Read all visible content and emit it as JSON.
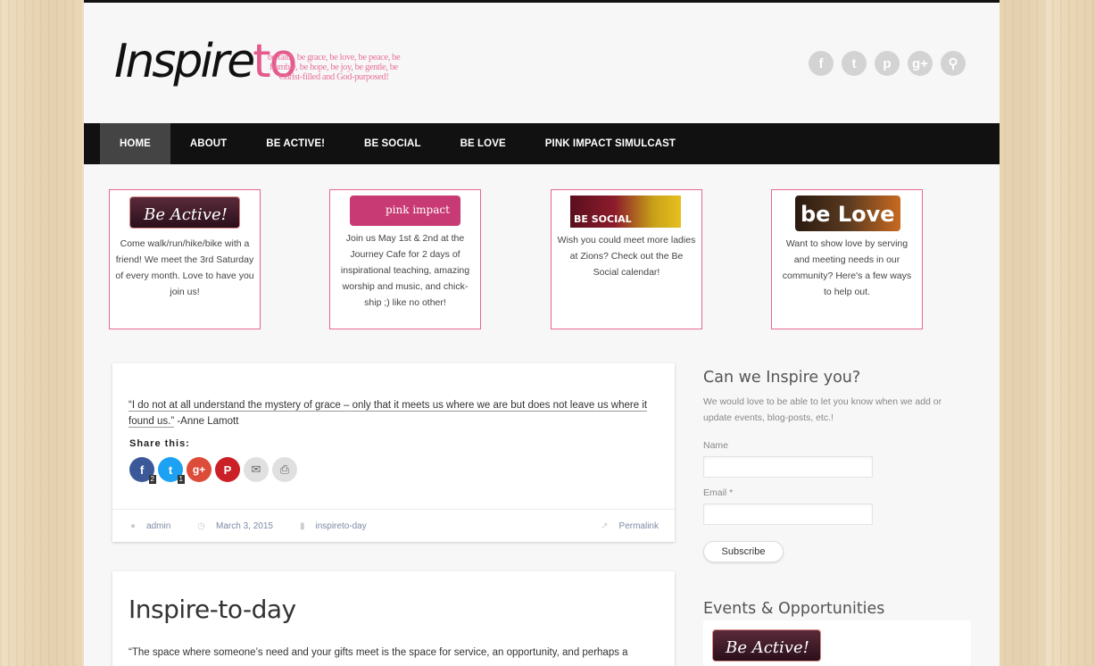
{
  "header": {
    "logo_main": "Inspire",
    "logo_accent": "to",
    "tagline": "be faith, be grace, be love, be peace, be humble, be hope, be joy, be gentle, be Christ-filled and God-purposed!",
    "social_icons": [
      {
        "name": "facebook-icon",
        "glyph": "f"
      },
      {
        "name": "twitter-icon",
        "glyph": "t"
      },
      {
        "name": "pinterest-icon",
        "glyph": "p"
      },
      {
        "name": "google-plus-icon",
        "glyph": "g+"
      },
      {
        "name": "search-icon",
        "glyph": "⚲"
      }
    ]
  },
  "nav": {
    "items": [
      "HOME",
      "ABOUT",
      "BE ACTIVE!",
      "BE SOCIAL",
      "BE LOVE",
      "PINK IMPACT SIMULCAST"
    ],
    "active_index": 0
  },
  "features": [
    {
      "badge": "Be Active!",
      "text": "Come walk/run/hike/bike with a friend! We meet the 3rd Saturday of every month. Love to have you join us!"
    },
    {
      "badge": "pink impact",
      "text": "Join us May 1st & 2nd at the Journey Cafe for 2 days of inspirational teaching, amazing worship and music, and chick-ship ;) like no other!"
    },
    {
      "badge": "BE SOCIAL",
      "text": "Wish you could meet more ladies at Zions? Check out the Be Social calendar!"
    },
    {
      "badge": "be Love",
      "text": "Want to show love by serving and meeting needs in our community? Here's a few ways to help out."
    }
  ],
  "post1": {
    "quote_link": "“I do not at all understand the mystery of grace – only that it meets us where we are but does not leave us where it found us.”",
    "quote_author": " -Anne Lamott",
    "share_title": "Share this:",
    "share_buttons": [
      {
        "name": "facebook-share-button",
        "glyph": "f",
        "count": "2",
        "color": "#3b5998"
      },
      {
        "name": "twitter-share-button",
        "glyph": "t",
        "count": "1",
        "color": "#1da1f2"
      },
      {
        "name": "google-plus-share-button",
        "glyph": "g+",
        "count": "",
        "color": "#dd4b39"
      },
      {
        "name": "pinterest-share-button",
        "glyph": "P",
        "count": "",
        "color": "#cb2027"
      },
      {
        "name": "email-share-button",
        "glyph": "✉",
        "count": "",
        "color": "#e0e0e0"
      },
      {
        "name": "print-share-button",
        "glyph": "⎙",
        "count": "",
        "color": "#e0e0e0"
      }
    ],
    "author": "admin",
    "date": "March 3, 2015",
    "category": "inspireto-day",
    "permalink": "Permalink"
  },
  "post2": {
    "title": "Inspire-to-day",
    "excerpt": "“The space where someone’s need and your gifts meet is the space for service, an opportunity, and perhaps a"
  },
  "sidebar": {
    "subscribe_heading": "Can we Inspire you?",
    "subscribe_text": "We would love to be able to let you know when we add or update events, blog-posts, etc.!",
    "name_label": "Name",
    "email_label": "Email *",
    "subscribe_button": "Subscribe",
    "events_heading": "Events & Opportunities",
    "events_badge": "Be Active!"
  },
  "colors": {
    "accent_pink": "#e45a8c",
    "nav_bg": "#111111",
    "nav_active": "#444444",
    "feature_border": "#e5688f",
    "link_meta": "#7c8aa5"
  }
}
